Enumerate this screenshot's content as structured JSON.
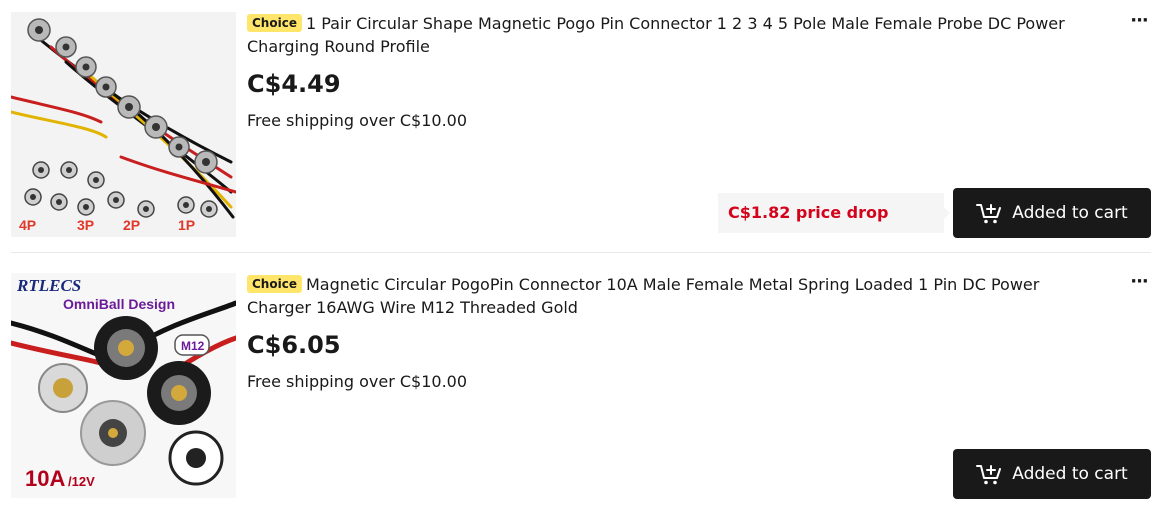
{
  "items": [
    {
      "badge": "Choice",
      "title": "1 Pair Circular Shape Magnetic Pogo Pin Connector 1 2 3 4 5 Pole Male Female Probe DC Power Charging Round Profile",
      "price": "C$4.49",
      "shipping": "Free shipping over C$10.00",
      "price_drop": "C$1.82 price drop",
      "cart_label": "Added to cart",
      "more": "···",
      "image_labels": [
        "4P",
        "3P",
        "2P",
        "1P"
      ]
    },
    {
      "badge": "Choice",
      "title": "Magnetic Circular PogoPin Connector 10A Male Female Metal Spring Loaded 1 Pin DC Power Charger 16AWG Wire M12 Threaded Gold",
      "price": "C$6.05",
      "shipping": "Free shipping over C$10.00",
      "cart_label": "Added to cart",
      "more": "···",
      "image_labels": {
        "brand": "RTLECS",
        "design": "OmniBall Design",
        "thread": "M12",
        "amp": "10A",
        "volt": "/12V"
      }
    }
  ],
  "colors": {
    "badge": "#ffe66b",
    "price_drop": "#d3031c",
    "cart_button": "#191919"
  },
  "icons": {
    "cart": "cart-added-icon",
    "more": "more-options-icon"
  }
}
